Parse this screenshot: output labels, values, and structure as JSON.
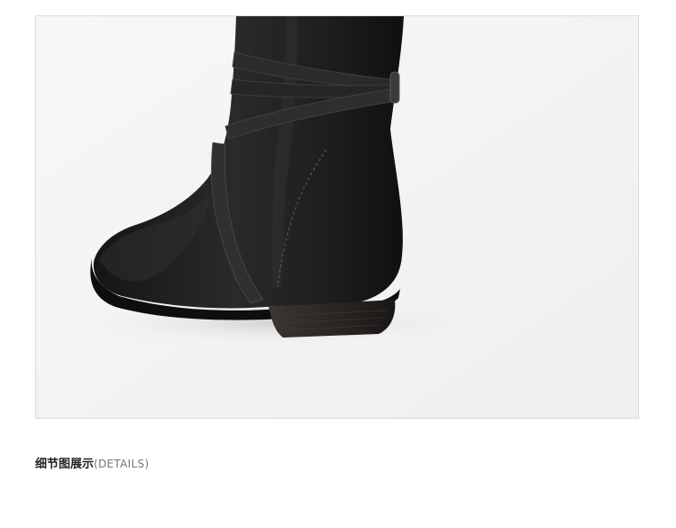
{
  "image": {
    "subject": "boot-photo"
  },
  "caption": {
    "title": "细节图展示",
    "subtitle": "(DETAILS)"
  },
  "colors": {
    "background": "#ffffff",
    "frame_border": "#dcdcdc",
    "frame_fill": "#f4f4f4",
    "boot_suede": "#1c1c1c",
    "strap": "#2b2b2b",
    "heel": "#2a2624"
  }
}
